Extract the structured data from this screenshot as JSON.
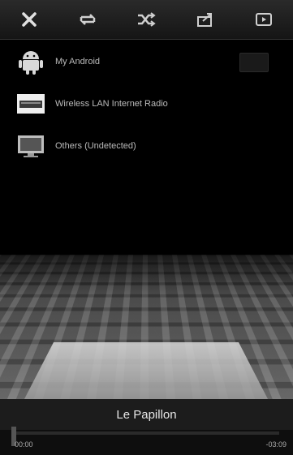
{
  "toolbar": {
    "buttons": [
      {
        "icon": "close-icon"
      },
      {
        "icon": "repeat-icon"
      },
      {
        "icon": "shuffle-icon"
      },
      {
        "icon": "share-icon"
      },
      {
        "icon": "play-box-icon"
      }
    ]
  },
  "devices": [
    {
      "label": "My Android",
      "icon": "android-icon"
    },
    {
      "label": "Wireless LAN Internet Radio",
      "icon": "radio-device-icon"
    },
    {
      "label": "Others (Undetected)",
      "icon": "monitor-icon"
    }
  ],
  "now_playing": {
    "title": "Le Papillon",
    "elapsed": "00:00",
    "remaining": "-03:09",
    "progress": 0.0
  }
}
